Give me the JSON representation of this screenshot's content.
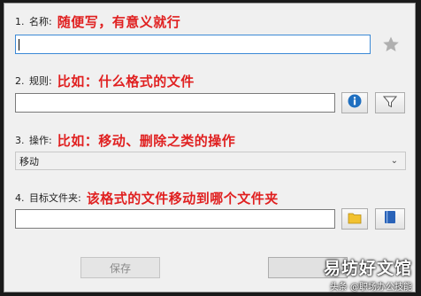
{
  "form": {
    "name": {
      "number": "1.",
      "label": "名称:",
      "annotation": "随便写，有意义就行",
      "value": ""
    },
    "rule": {
      "number": "2.",
      "label": "规则:",
      "annotation": "比如：什么格式的文件",
      "value": ""
    },
    "action": {
      "number": "3.",
      "label": "操作:",
      "annotation": "比如：移动、删除之类的操作",
      "selected": "移动"
    },
    "target": {
      "number": "4.",
      "label": "目标文件夹:",
      "annotation": "该格式的文件移动到哪个文件夹",
      "value": ""
    }
  },
  "buttons": {
    "save_label": "保存",
    "ok_label": ""
  },
  "watermark": {
    "title": "易坊好文馆",
    "subtitle": "头条 @职场办公技能"
  },
  "colors": {
    "annotation": "#e02020",
    "star": "#b0b0b0",
    "info": "#1f6fc0",
    "folder": "#f2c230",
    "book": "#2a63b8"
  },
  "icons": [
    "star-icon",
    "info-icon",
    "filter-icon",
    "folder-icon",
    "book-icon",
    "chevron-down-icon"
  ]
}
